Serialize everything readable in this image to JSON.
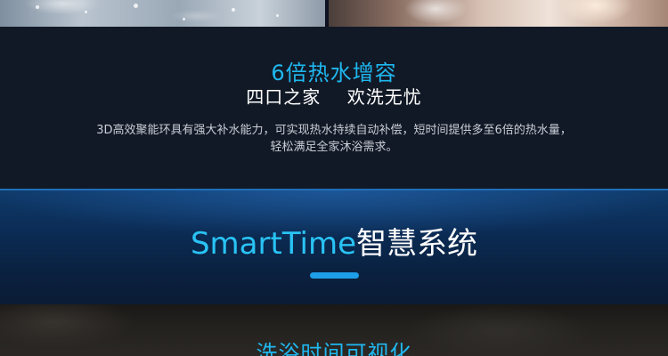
{
  "feature": {
    "title": "6倍热水增容",
    "subtitle": "四口之家    欢洗无忧",
    "description_lines": [
      "3D高效聚能环具有强大补水能力，可实现热水持续自动补偿，短时间提供多至6倍的热水量，",
      "轻松满足全家沐浴需求。"
    ]
  },
  "banner": {
    "title_en": "SmartTime",
    "title_zh": "智慧系统"
  },
  "bottom": {
    "title": "洗浴时间可视化"
  },
  "colors": {
    "accent_blue": "#1fb8f0",
    "background": "#121926",
    "banner_blue": "#0b2c55"
  }
}
